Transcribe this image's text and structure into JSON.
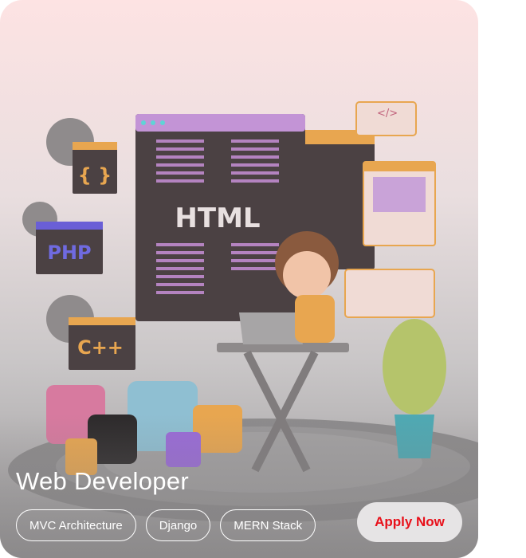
{
  "card": {
    "title": "Web Developer",
    "tags": [
      "MVC Architecture",
      "Django",
      "MERN Stack"
    ],
    "apply_label": "Apply Now",
    "colors": {
      "apply_text": "#e8101a",
      "apply_bg": "#e6e4e5",
      "card_top": "#fde3e3",
      "card_bottom": "#9a9899"
    }
  },
  "illustration": {
    "labels": {
      "html": "HTML",
      "php": "PHP",
      "cpp": "C++",
      "braces": "{ }",
      "code": "</>"
    }
  }
}
